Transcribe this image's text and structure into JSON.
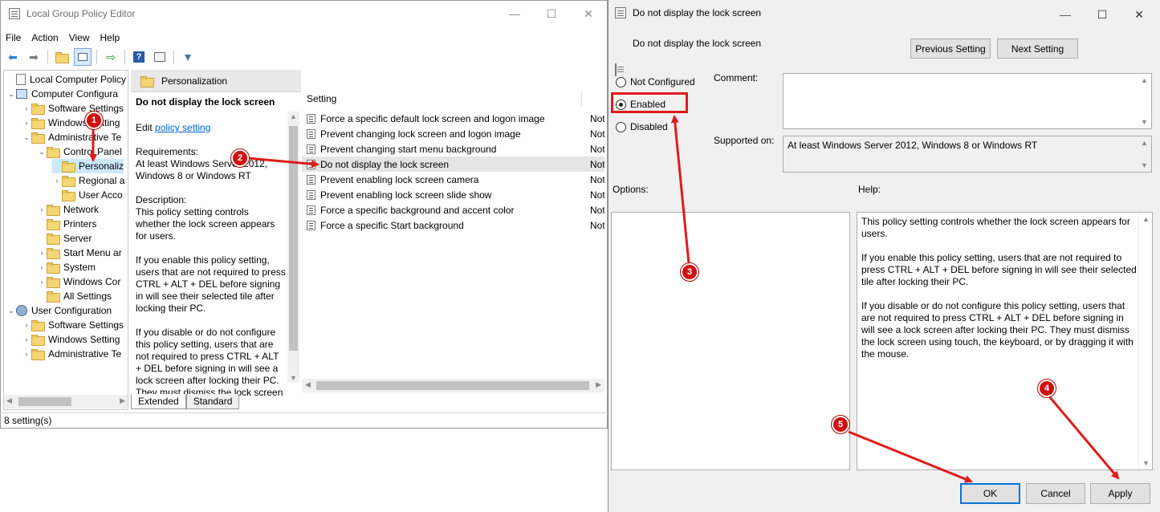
{
  "main_window": {
    "title": "Local Group Policy Editor",
    "minimize": "—",
    "maximize": "☐",
    "close": "✕",
    "menu": [
      "File",
      "Action",
      "View",
      "Help"
    ],
    "toolbar_icons": [
      "back-arrow",
      "forward-arrow",
      "up-folder",
      "show-hide-tree",
      "export-list",
      "help",
      "properties",
      "filter"
    ],
    "tree": [
      {
        "label": "Local Computer Policy",
        "icon": "doc"
      },
      {
        "label": "Computer Configura",
        "icon": "pc"
      },
      {
        "label": "Software Settings",
        "icon": "folder"
      },
      {
        "label": "Windows Setting",
        "icon": "folder"
      },
      {
        "label": "Administrative Te",
        "icon": "folder"
      },
      {
        "label": "Control Panel",
        "icon": "folder"
      },
      {
        "label": "Personaliz",
        "icon": "folder"
      },
      {
        "label": "Regional a",
        "icon": "folder"
      },
      {
        "label": "User Acco",
        "icon": "folder"
      },
      {
        "label": "Network",
        "icon": "folder"
      },
      {
        "label": "Printers",
        "icon": "folder"
      },
      {
        "label": "Server",
        "icon": "folder"
      },
      {
        "label": "Start Menu ar",
        "icon": "folder"
      },
      {
        "label": "System",
        "icon": "folder"
      },
      {
        "label": "Windows Cor",
        "icon": "folder"
      },
      {
        "label": "All Settings",
        "icon": "folder"
      },
      {
        "label": "User Configuration",
        "icon": "user"
      },
      {
        "label": "Software Settings",
        "icon": "folder"
      },
      {
        "label": "Windows Setting",
        "icon": "folder"
      },
      {
        "label": "Administrative Te",
        "icon": "folder"
      }
    ],
    "pane_header": "Personalization",
    "description": {
      "title": "Do not display the lock screen",
      "edit_prefix": "Edit ",
      "edit_link": "policy setting",
      "requirements_label": "Requirements:",
      "requirements_1": "At least Windows Server 2012,",
      "requirements_2": "Windows 8 or Windows RT",
      "description_label": "Description:",
      "lines": [
        "This policy setting controls",
        "whether the lock screen appears",
        "for users.",
        "",
        "If you enable this policy setting,",
        "users that are not required to press",
        "CTRL + ALT + DEL before signing",
        "in will see their selected tile after",
        "locking their PC.",
        "",
        "If you disable or do not configure",
        "this policy setting, users that are",
        "not required to press CTRL + ALT",
        "+ DEL before signing in will see a",
        "lock screen after locking their PC.",
        "They must dismiss the lock screen"
      ]
    },
    "list_header": "Setting",
    "settings": [
      {
        "name": "Force a specific default lock screen and logon image",
        "state": "Not"
      },
      {
        "name": "Prevent changing lock screen and logon image",
        "state": "Not"
      },
      {
        "name": "Prevent changing start menu background",
        "state": "Not"
      },
      {
        "name": "Do not display the lock screen",
        "state": "Not"
      },
      {
        "name": "Prevent enabling lock screen camera",
        "state": "Not"
      },
      {
        "name": "Prevent enabling lock screen slide show",
        "state": "Not"
      },
      {
        "name": "Force a specific background and accent color",
        "state": "Not"
      },
      {
        "name": "Force a specific Start background",
        "state": "Not"
      }
    ],
    "tabs": [
      "Extended",
      "Standard"
    ],
    "status": "8 setting(s)"
  },
  "dialog": {
    "title": "Do not display the lock screen",
    "minimize": "—",
    "maximize": "☐",
    "close": "✕",
    "policy_name": "Do not display the lock screen",
    "prev_button": "Previous Setting",
    "next_button": "Next Setting",
    "radio_options": [
      "Not Configured",
      "Enabled",
      "Disabled"
    ],
    "selected": "Enabled",
    "comment_label": "Comment:",
    "comment_value": "",
    "supported_label": "Supported on:",
    "supported_value": "At least Windows Server 2012, Windows 8 or Windows RT",
    "options_label": "Options:",
    "help_label": "Help:",
    "help_paragraphs": [
      "This policy setting controls whether the lock screen appears for users.",
      "If you enable this policy setting, users that are not required to press CTRL + ALT + DEL before signing in will see their selected tile after locking their PC.",
      "If you disable or do not configure this policy setting, users that are not required to press CTRL + ALT + DEL before signing in will see a lock screen after locking their PC. They must dismiss the lock screen using touch, the keyboard, or by dragging it with the mouse."
    ],
    "ok_button": "OK",
    "cancel_button": "Cancel",
    "apply_button": "Apply"
  },
  "annotations": {
    "badges": [
      "1",
      "2",
      "3",
      "4",
      "5"
    ],
    "color": "#d01010"
  }
}
